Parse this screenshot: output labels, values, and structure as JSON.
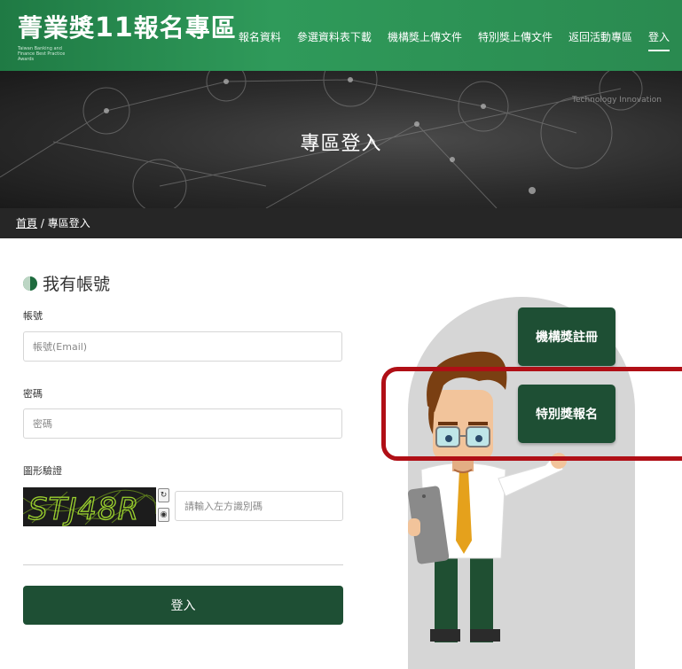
{
  "header": {
    "logo_main": "菁業獎",
    "logo_number": "11",
    "logo_suffix": "報名專區",
    "logo_sub": "Taiwan Banking and Finance Best Practice Awards",
    "nav": [
      "報名資料",
      "參選資料表下載",
      "機構獎上傳文件",
      "特別獎上傳文件",
      "返回活動專區",
      "登入"
    ],
    "active_nav": "登入"
  },
  "banner": {
    "title": "專區登入",
    "bg_text": "Technology Innovation"
  },
  "breadcrumb": {
    "home": "首頁",
    "separator": " / ",
    "current": "專區登入"
  },
  "form": {
    "section_title": "我有帳號",
    "account_label": "帳號",
    "account_placeholder": "帳號(Email)",
    "password_label": "密碼",
    "password_placeholder": "密碼",
    "captcha_label": "圖形驗證",
    "captcha_text": "STJ48R",
    "captcha_placeholder": "請輸入左方識別碼",
    "login_label": "登入"
  },
  "side": {
    "institution_button": "機構獎註冊",
    "special_button": "特別獎報名"
  },
  "colors": {
    "header_green": "#2a8a50",
    "dark_green": "#1e4f34",
    "highlight_red": "#b00f16"
  }
}
